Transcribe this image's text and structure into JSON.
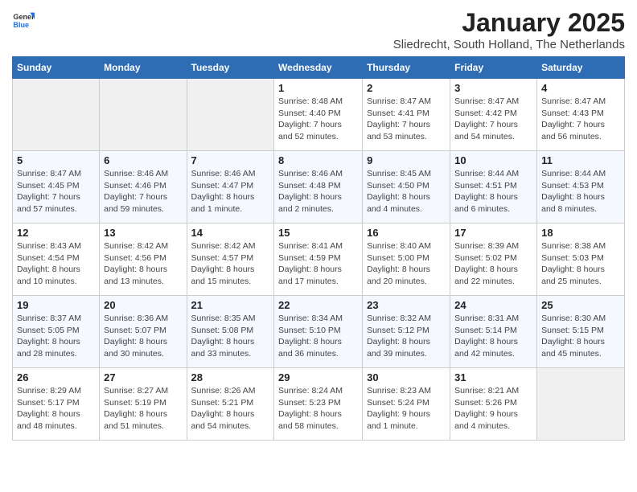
{
  "header": {
    "logo_general": "General",
    "logo_blue": "Blue",
    "title": "January 2025",
    "subtitle": "Sliedrecht, South Holland, The Netherlands"
  },
  "days_of_week": [
    "Sunday",
    "Monday",
    "Tuesday",
    "Wednesday",
    "Thursday",
    "Friday",
    "Saturday"
  ],
  "weeks": [
    {
      "days": [
        {
          "number": "",
          "empty": true
        },
        {
          "number": "",
          "empty": true
        },
        {
          "number": "",
          "empty": true
        },
        {
          "number": "1",
          "sunrise": "Sunrise: 8:48 AM",
          "sunset": "Sunset: 4:40 PM",
          "daylight": "Daylight: 7 hours and 52 minutes."
        },
        {
          "number": "2",
          "sunrise": "Sunrise: 8:47 AM",
          "sunset": "Sunset: 4:41 PM",
          "daylight": "Daylight: 7 hours and 53 minutes."
        },
        {
          "number": "3",
          "sunrise": "Sunrise: 8:47 AM",
          "sunset": "Sunset: 4:42 PM",
          "daylight": "Daylight: 7 hours and 54 minutes."
        },
        {
          "number": "4",
          "sunrise": "Sunrise: 8:47 AM",
          "sunset": "Sunset: 4:43 PM",
          "daylight": "Daylight: 7 hours and 56 minutes."
        }
      ]
    },
    {
      "days": [
        {
          "number": "5",
          "sunrise": "Sunrise: 8:47 AM",
          "sunset": "Sunset: 4:45 PM",
          "daylight": "Daylight: 7 hours and 57 minutes."
        },
        {
          "number": "6",
          "sunrise": "Sunrise: 8:46 AM",
          "sunset": "Sunset: 4:46 PM",
          "daylight": "Daylight: 7 hours and 59 minutes."
        },
        {
          "number": "7",
          "sunrise": "Sunrise: 8:46 AM",
          "sunset": "Sunset: 4:47 PM",
          "daylight": "Daylight: 8 hours and 1 minute."
        },
        {
          "number": "8",
          "sunrise": "Sunrise: 8:46 AM",
          "sunset": "Sunset: 4:48 PM",
          "daylight": "Daylight: 8 hours and 2 minutes."
        },
        {
          "number": "9",
          "sunrise": "Sunrise: 8:45 AM",
          "sunset": "Sunset: 4:50 PM",
          "daylight": "Daylight: 8 hours and 4 minutes."
        },
        {
          "number": "10",
          "sunrise": "Sunrise: 8:44 AM",
          "sunset": "Sunset: 4:51 PM",
          "daylight": "Daylight: 8 hours and 6 minutes."
        },
        {
          "number": "11",
          "sunrise": "Sunrise: 8:44 AM",
          "sunset": "Sunset: 4:53 PM",
          "daylight": "Daylight: 8 hours and 8 minutes."
        }
      ]
    },
    {
      "days": [
        {
          "number": "12",
          "sunrise": "Sunrise: 8:43 AM",
          "sunset": "Sunset: 4:54 PM",
          "daylight": "Daylight: 8 hours and 10 minutes."
        },
        {
          "number": "13",
          "sunrise": "Sunrise: 8:42 AM",
          "sunset": "Sunset: 4:56 PM",
          "daylight": "Daylight: 8 hours and 13 minutes."
        },
        {
          "number": "14",
          "sunrise": "Sunrise: 8:42 AM",
          "sunset": "Sunset: 4:57 PM",
          "daylight": "Daylight: 8 hours and 15 minutes."
        },
        {
          "number": "15",
          "sunrise": "Sunrise: 8:41 AM",
          "sunset": "Sunset: 4:59 PM",
          "daylight": "Daylight: 8 hours and 17 minutes."
        },
        {
          "number": "16",
          "sunrise": "Sunrise: 8:40 AM",
          "sunset": "Sunset: 5:00 PM",
          "daylight": "Daylight: 8 hours and 20 minutes."
        },
        {
          "number": "17",
          "sunrise": "Sunrise: 8:39 AM",
          "sunset": "Sunset: 5:02 PM",
          "daylight": "Daylight: 8 hours and 22 minutes."
        },
        {
          "number": "18",
          "sunrise": "Sunrise: 8:38 AM",
          "sunset": "Sunset: 5:03 PM",
          "daylight": "Daylight: 8 hours and 25 minutes."
        }
      ]
    },
    {
      "days": [
        {
          "number": "19",
          "sunrise": "Sunrise: 8:37 AM",
          "sunset": "Sunset: 5:05 PM",
          "daylight": "Daylight: 8 hours and 28 minutes."
        },
        {
          "number": "20",
          "sunrise": "Sunrise: 8:36 AM",
          "sunset": "Sunset: 5:07 PM",
          "daylight": "Daylight: 8 hours and 30 minutes."
        },
        {
          "number": "21",
          "sunrise": "Sunrise: 8:35 AM",
          "sunset": "Sunset: 5:08 PM",
          "daylight": "Daylight: 8 hours and 33 minutes."
        },
        {
          "number": "22",
          "sunrise": "Sunrise: 8:34 AM",
          "sunset": "Sunset: 5:10 PM",
          "daylight": "Daylight: 8 hours and 36 minutes."
        },
        {
          "number": "23",
          "sunrise": "Sunrise: 8:32 AM",
          "sunset": "Sunset: 5:12 PM",
          "daylight": "Daylight: 8 hours and 39 minutes."
        },
        {
          "number": "24",
          "sunrise": "Sunrise: 8:31 AM",
          "sunset": "Sunset: 5:14 PM",
          "daylight": "Daylight: 8 hours and 42 minutes."
        },
        {
          "number": "25",
          "sunrise": "Sunrise: 8:30 AM",
          "sunset": "Sunset: 5:15 PM",
          "daylight": "Daylight: 8 hours and 45 minutes."
        }
      ]
    },
    {
      "days": [
        {
          "number": "26",
          "sunrise": "Sunrise: 8:29 AM",
          "sunset": "Sunset: 5:17 PM",
          "daylight": "Daylight: 8 hours and 48 minutes."
        },
        {
          "number": "27",
          "sunrise": "Sunrise: 8:27 AM",
          "sunset": "Sunset: 5:19 PM",
          "daylight": "Daylight: 8 hours and 51 minutes."
        },
        {
          "number": "28",
          "sunrise": "Sunrise: 8:26 AM",
          "sunset": "Sunset: 5:21 PM",
          "daylight": "Daylight: 8 hours and 54 minutes."
        },
        {
          "number": "29",
          "sunrise": "Sunrise: 8:24 AM",
          "sunset": "Sunset: 5:23 PM",
          "daylight": "Daylight: 8 hours and 58 minutes."
        },
        {
          "number": "30",
          "sunrise": "Sunrise: 8:23 AM",
          "sunset": "Sunset: 5:24 PM",
          "daylight": "Daylight: 9 hours and 1 minute."
        },
        {
          "number": "31",
          "sunrise": "Sunrise: 8:21 AM",
          "sunset": "Sunset: 5:26 PM",
          "daylight": "Daylight: 9 hours and 4 minutes."
        },
        {
          "number": "",
          "empty": true
        }
      ]
    }
  ]
}
